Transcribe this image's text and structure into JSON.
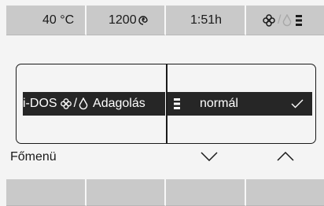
{
  "status": {
    "temperature": "40 °C",
    "spin_speed": "1200",
    "time_remaining": "1:51h"
  },
  "menu": {
    "left_item": {
      "prefix": "i-DOS",
      "separator": "/",
      "label": "Adagolás"
    },
    "right_item": {
      "value": "normál"
    }
  },
  "footer": {
    "main_menu_label": "Főmenü"
  },
  "icons": {
    "spin": "spin-icon",
    "fabric_softener": "flower-icon",
    "detergent": "drop-icon",
    "dosage_level": "dosage-bars-icon",
    "selected": "checkmark-icon",
    "down": "chevron-down-icon",
    "up": "chevron-up-icon"
  },
  "colors": {
    "screen_bg": "#f4f4f4",
    "key_bg": "#c9c9c9",
    "highlight_bg": "#262626",
    "text": "#1a1a1a",
    "muted": "#a8a8a8"
  }
}
